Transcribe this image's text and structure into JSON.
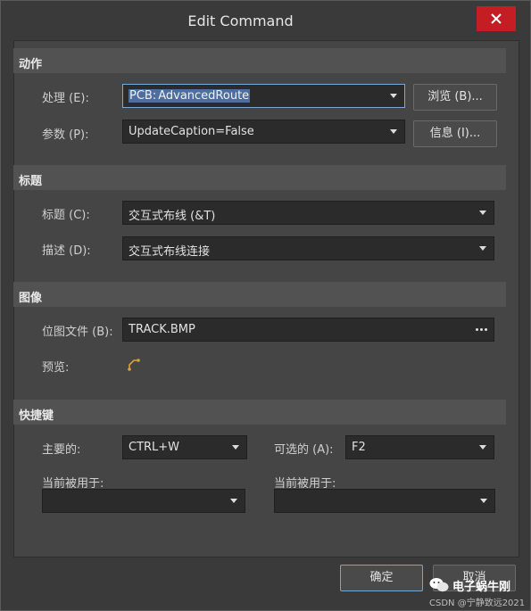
{
  "window": {
    "title": "Edit Command"
  },
  "sections": {
    "action": {
      "header": "动作",
      "process_label": "处理 (E):",
      "process_value_prefix": "PCB:",
      "process_value_selected": "AdvancedRoute",
      "browse_button": "浏览 (B)...",
      "params_label": "参数 (P):",
      "params_value": "UpdateCaption=False",
      "info_button": "信息 (I)..."
    },
    "caption": {
      "header": "标题",
      "title_label": "标题 (C):",
      "title_value": "交互式布线 (&T)",
      "desc_label": "描述 (D):",
      "desc_value": "交互式布线连接"
    },
    "image": {
      "header": "图像",
      "bitmap_label": "位图文件 (B):",
      "bitmap_value": "TRACK.BMP",
      "preview_label": "预览:"
    },
    "shortcut": {
      "header": "快捷键",
      "primary_label": "主要的:",
      "primary_value": "CTRL+W",
      "alt_label": "可选的 (A):",
      "alt_value": "F2",
      "primary_used_label": "当前被用于:",
      "primary_used_value": "",
      "alt_used_label": "当前被用于:",
      "alt_used_value": ""
    }
  },
  "footer": {
    "ok_button": "确定",
    "cancel_button": "取消"
  },
  "watermark": {
    "brand": "电子蜗牛刚",
    "credit": "CSDN @宁静致远2021"
  },
  "colors": {
    "close": "#c41e24",
    "accent_border": "#7aa9d6",
    "selection": "#4d6fa0",
    "preview_icon": "#d9a13a"
  }
}
